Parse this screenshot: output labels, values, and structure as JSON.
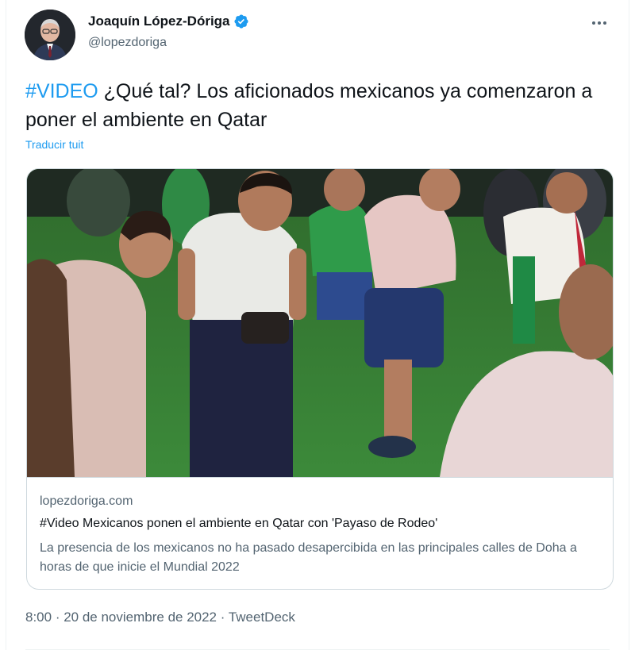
{
  "author": {
    "name": "Joaquín López-Dóriga",
    "handle": "@lopezdoriga",
    "verified_color": "#1d9bf0"
  },
  "tweet": {
    "hashtag": "#VIDEO",
    "text": " ¿Qué tal? Los aficionados mexicanos ya comenzaron a poner el ambiente en Qatar",
    "translate_label": "Traducir tuit"
  },
  "card": {
    "domain": "lopezdoriga.com",
    "title": "#Video Mexicanos ponen el ambiente en Qatar con 'Payaso de Rodeo'",
    "description": "La presencia de los mexicanos no ha pasado desapercibida en las principales calles de Doha a horas de que inicie el Mundial 2022"
  },
  "meta": {
    "time": "8:00",
    "sep1": " · ",
    "date": "20 de noviembre de 2022",
    "sep2": " · ",
    "source": "TweetDeck"
  },
  "colors": {
    "link": "#1d9bf0",
    "secondary_text": "#536471",
    "border": "#cfd9de"
  }
}
